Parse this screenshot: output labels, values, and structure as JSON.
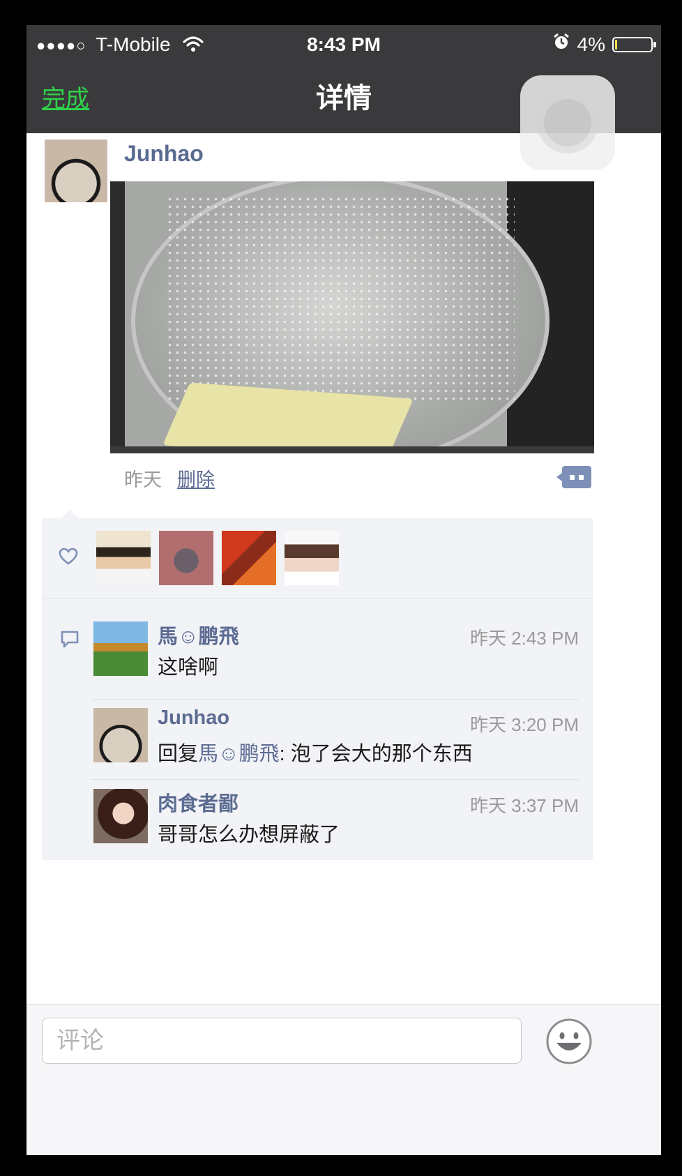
{
  "status_bar": {
    "signal": "●●●●○",
    "carrier": "T-Mobile",
    "time": "8:43 PM",
    "battery_text": "4%",
    "battery_level": 0.04
  },
  "nav": {
    "done_label": "完成",
    "title": "详情"
  },
  "post": {
    "author": "Junhao",
    "time": "昨天",
    "delete_label": "删除"
  },
  "likes": {
    "count": 4
  },
  "comments": [
    {
      "name": "馬☺鹏飛",
      "time": "昨天 2:43 PM",
      "text": "这啥啊"
    },
    {
      "name": "Junhao",
      "time": "昨天 3:20 PM",
      "reply_prefix": "回复",
      "reply_to": "馬☺鹏飛",
      "text": ": 泡了会大的那个东西"
    },
    {
      "name": "肉食者鄙",
      "time": "昨天 3:37 PM",
      "text": "哥哥怎么办想屏蔽了"
    }
  ],
  "comment_box": {
    "placeholder": "评论"
  },
  "colors": {
    "nav_bg": "#3a3a3c",
    "accent_green": "#2fd24a",
    "link_blue": "#5b6b92",
    "panel_bg": "#f2f3f6"
  },
  "icons": [
    "wifi-icon",
    "alarm-icon",
    "battery-icon",
    "heart-icon",
    "comment-bubble-icon",
    "comment-action-icon",
    "emoji-icon"
  ]
}
